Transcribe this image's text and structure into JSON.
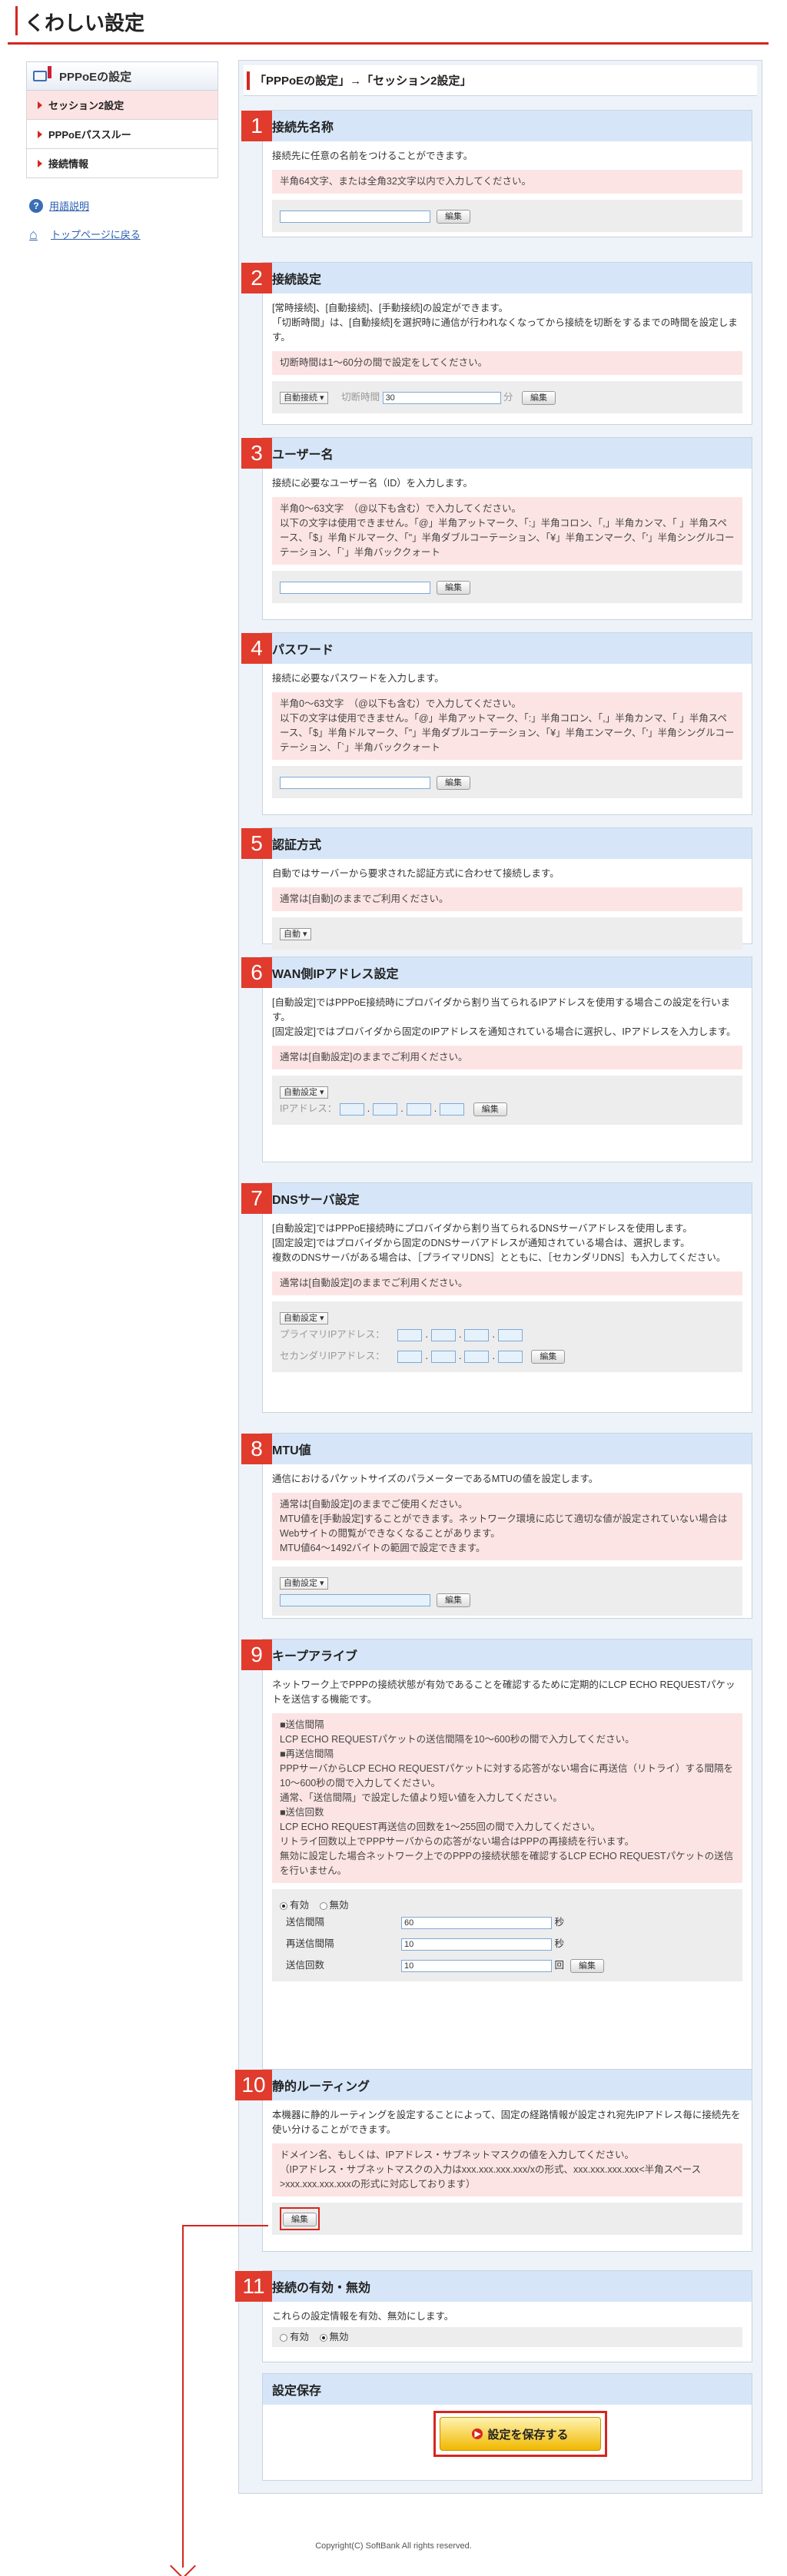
{
  "page_title": "くわしい設定",
  "sidebar": {
    "header": "PPPoEの設定",
    "items": [
      "セッション2設定",
      "PPPoEパススルー",
      "接続情報"
    ],
    "links": [
      "用語説明",
      "トップページに戻る"
    ]
  },
  "main_title": "「PPPoEの設定」→「セッション2設定」",
  "sections": {
    "s1": {
      "num": "1",
      "title": "接続先名称",
      "desc": "接続先に任意の名前をつけることができます。",
      "note": "半角64文字、または全角32文字以内で入力してください。",
      "btn": "編集"
    },
    "s2": {
      "num": "2",
      "title": "接続設定",
      "desc1": "[常時接続]、[自動接続]、[手動接続]の設定ができます。",
      "desc2": "「切断時間」は、[自動接続]を選択時に通信が行われなくなってから接続を切断をするまでの時間を設定します。",
      "note": "切断時間は1～60分の間で設定をしてください。",
      "select": "自動接続",
      "label": "切断時間",
      "value": "30",
      "unit": "分",
      "btn": "編集"
    },
    "s3": {
      "num": "3",
      "title": "ユーザー名",
      "desc": "接続に必要なユーザー名（ID）を入力します。",
      "note1": "半角0～63文字　（@以下も含む）で入力してください。",
      "note2": "以下の文字は使用できません。「@」半角アットマーク、「:」半角コロン、「,」半角カンマ、「 」半角スペース、「$」半角ドルマーク、「\"」半角ダブルコーテーション、「¥」半角エンマーク、「'」半角シングルコーテーション、「`」半角バッククォート",
      "btn": "編集"
    },
    "s4": {
      "num": "4",
      "title": "パスワード",
      "desc": "接続に必要なパスワードを入力します。",
      "note1": "半角0～63文字　（@以下も含む）で入力してください。",
      "note2": "以下の文字は使用できません。「@」半角アットマーク、「:」半角コロン、「,」半角カンマ、「 」半角スペース、「$」半角ドルマーク、「\"」半角ダブルコーテーション、「¥」半角エンマーク、「'」半角シングルコーテーション、「`」半角バッククォート",
      "btn": "編集"
    },
    "s5": {
      "num": "5",
      "title": "認証方式",
      "desc": "自動ではサーバーから要求された認証方式に合わせて接続します。",
      "note": "通常は[自動]のままでご利用ください。",
      "select": "自動"
    },
    "s6": {
      "num": "6",
      "title": "WAN側IPアドレス設定",
      "desc1": "[自動設定]ではPPPoE接続時にプロバイダから割り当てられるIPアドレスを使用する場合この設定を行います。",
      "desc2": "[固定設定]ではプロバイダから固定のIPアドレスを通知されている場合に選択し、IPアドレスを入力します。",
      "note": "通常は[自動設定]のままでご利用ください。",
      "select": "自動設定",
      "label": "IPアドレス：",
      "btn": "編集"
    },
    "s7": {
      "num": "7",
      "title": "DNSサーバ設定",
      "desc1": "[自動設定]ではPPPoE接続時にプロバイダから割り当てられるDNSサーバアドレスを使用します。",
      "desc2": "[固定設定]ではプロバイダから固定のDNSサーバアドレスが通知されている場合は、選択します。",
      "desc3": "複数のDNSサーバがある場合は、［プライマリDNS］とともに、［セカンダリDNS］も入力してください。",
      "note": "通常は[自動設定]のままでご利用ください。",
      "select": "自動設定",
      "label1": "プライマリIPアドレス：",
      "label2": "セカンダリIPアドレス：",
      "btn": "編集"
    },
    "s8": {
      "num": "8",
      "title": "MTU値",
      "desc": "通信におけるパケットサイズのパラメーターであるMTUの値を設定します。",
      "note1": "通常は[自動設定]のままでご使用ください。",
      "note2": "MTU値を[手動設定]することができます。ネットワーク環境に応じて適切な値が設定されていない場合はWebサイトの閲覧ができなくなることがあります。",
      "note3": "MTU値64～1492バイトの範囲で設定できます。",
      "select": "自動設定",
      "btn": "編集"
    },
    "s9": {
      "num": "9",
      "title": "キープアライブ",
      "desc": "ネットワーク上でPPPの接続状態が有効であることを確認するために定期的にLCP ECHO REQUESTパケットを送信する機能です。",
      "n1": "■送信間隔",
      "n2": "LCP ECHO REQUESTパケットの送信間隔を10～600秒の間で入力してください。",
      "n3": "■再送信間隔",
      "n4": "PPPサーバからLCP ECHO REQUESTパケットに対する応答がない場合に再送信（リトライ）する間隔を10～600秒の間で入力してください。",
      "n5": "通常、「送信間隔」で設定した値より短い値を入力してください。",
      "n6": "■送信回数",
      "n7": "LCP ECHO REQUEST再送信の回数を1～255回の間で入力してください。",
      "n8": "リトライ回数以上でPPPサーバからの応答がない場合はPPPの再接続を行います。",
      "n9": "無効に設定した場合ネットワーク上でのPPPの接続状態を確認するLCP ECHO REQUESTパケットの送信を行いません。",
      "r_on": "有効",
      "r_off": "無効",
      "l1": "送信間隔",
      "v1": "60",
      "u1": "秒",
      "l2": "再送信間隔",
      "v2": "10",
      "u2": "秒",
      "l3": "送信回数",
      "v3": "10",
      "u3": "回",
      "btn": "編集"
    },
    "s10": {
      "num": "10",
      "title": "静的ルーティング",
      "desc": "本機器に静的ルーティングを設定することによって、固定の経路情報が設定され宛先IPアドレス毎に接続先を使い分けることができます。",
      "note1": "ドメイン名、もしくは、IPアドレス・サブネットマスクの値を入力してください。",
      "note2": "（IPアドレス・サブネットマスクの入力はxxx.xxx.xxx.xxx/xの形式、xxx.xxx.xxx.xxx<半角スペース>xxx.xxx.xxx.xxxの形式に対応しております）",
      "btn": "編集"
    },
    "s11": {
      "num": "11",
      "title": "接続の有効・無効",
      "desc": "これらの設定情報を有効、無効にします。",
      "r_on": "有効",
      "r_off": "無効"
    },
    "save": {
      "title": "設定保存",
      "btn": "設定を保存する"
    }
  },
  "footer": "Copyright(C) SoftBank All rights reserved.",
  "colors": {
    "accent": "#d6261f",
    "section_head": "#d6e6f8",
    "note_bg": "#fde4e4"
  }
}
